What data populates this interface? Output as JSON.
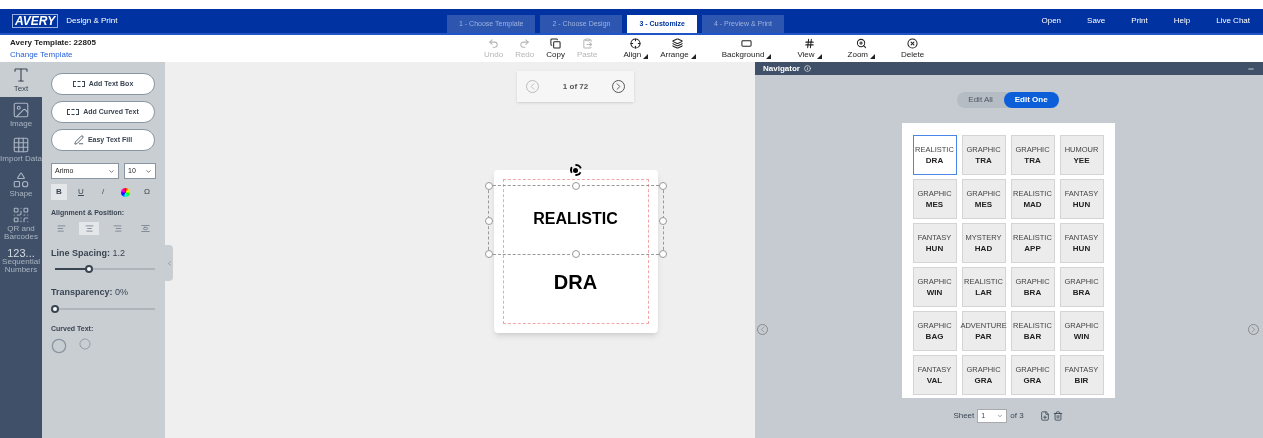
{
  "header": {
    "logo": "AVERY",
    "app_name": "Design & Print",
    "steps": [
      {
        "label": "1 - Choose Template",
        "selected": false
      },
      {
        "label": "2 - Choose Design",
        "selected": false
      },
      {
        "label": "3 - Customize",
        "selected": true
      },
      {
        "label": "4 - Preview & Print",
        "selected": false
      }
    ],
    "menu": [
      "Open",
      "Save",
      "Print",
      "Help",
      "Live Chat"
    ]
  },
  "template": {
    "title": "Avery Template: 22805",
    "link": "Change Template"
  },
  "toolbar": [
    {
      "kind": "undo",
      "label": "Undo",
      "disabled": true,
      "dropdown": false
    },
    {
      "kind": "redo",
      "label": "Redo",
      "disabled": true,
      "dropdown": false
    },
    {
      "kind": "copy",
      "label": "Copy",
      "disabled": false,
      "dropdown": false
    },
    {
      "kind": "paste",
      "label": "Paste",
      "disabled": true,
      "dropdown": false
    },
    {
      "kind": "align",
      "label": "Align",
      "disabled": false,
      "dropdown": true
    },
    {
      "kind": "arrange",
      "label": "Arrange",
      "disabled": false,
      "dropdown": true
    },
    {
      "kind": "background",
      "label": "Background",
      "disabled": false,
      "dropdown": true
    },
    {
      "kind": "view",
      "label": "View",
      "disabled": false,
      "dropdown": true
    },
    {
      "kind": "zoom",
      "label": "Zoom",
      "disabled": false,
      "dropdown": true
    },
    {
      "kind": "delete",
      "label": "Delete",
      "disabled": false,
      "dropdown": false
    }
  ],
  "rail": [
    {
      "kind": "text",
      "label": "Text",
      "selected": true
    },
    {
      "kind": "image",
      "label": "Image",
      "selected": false
    },
    {
      "kind": "data",
      "label": "Import Data",
      "selected": false
    },
    {
      "kind": "shape",
      "label": "Shape",
      "selected": false
    },
    {
      "kind": "qr",
      "label": "QR and Barcodes",
      "selected": false
    },
    {
      "kind": "numbers",
      "glyph": "123...",
      "label": "Sequential Numbers",
      "selected": false
    }
  ],
  "panel": {
    "buttons": [
      {
        "kind": "textbox",
        "label": "Add Text Box"
      },
      {
        "kind": "curved",
        "label": "Add Curved Text"
      },
      {
        "kind": "fill",
        "label": "Easy Text Fill"
      }
    ],
    "font": "Arimo",
    "size": "10",
    "format": [
      {
        "kind": "bold",
        "glyph": "B",
        "selected": true
      },
      {
        "kind": "underline",
        "glyph": "U",
        "selected": false
      },
      {
        "kind": "italic",
        "glyph": "/",
        "selected": false
      },
      {
        "kind": "color",
        "selected": false
      },
      {
        "kind": "symbol",
        "glyph": "Ω",
        "selected": false
      }
    ],
    "alignment_heading": "Alignment & Position:",
    "alignment": [
      {
        "kind": "left",
        "selected": false
      },
      {
        "kind": "center",
        "selected": true
      },
      {
        "kind": "right",
        "selected": false
      },
      {
        "kind": "position",
        "selected": false
      }
    ],
    "line_spacing": {
      "label": "Line Spacing:",
      "reading": "1.2",
      "level": 0.34
    },
    "transparency": {
      "label": "Transparency:",
      "reading": "0%",
      "level": 0
    },
    "curved_heading": "Curved Text:"
  },
  "canvas": {
    "pager": "1 of 72",
    "lines": [
      "REALISTIC",
      "DRA"
    ]
  },
  "navigator": {
    "title": "Navigator",
    "modes": [
      {
        "label": "Edit All",
        "selected": false
      },
      {
        "label": "Edit One",
        "selected": true
      }
    ],
    "cells": [
      {
        "category": "REALISTIC",
        "name": "DRA",
        "selected": true
      },
      {
        "category": "GRAPHIC",
        "name": "TRA",
        "selected": false
      },
      {
        "category": "GRAPHIC",
        "name": "TRA",
        "selected": false
      },
      {
        "category": "HUMOUR",
        "name": "YEE",
        "selected": false
      },
      {
        "category": "GRAPHIC",
        "name": "MES",
        "selected": false
      },
      {
        "category": "GRAPHIC",
        "name": "MES",
        "selected": false
      },
      {
        "category": "REALISTIC",
        "name": "MAD",
        "selected": false
      },
      {
        "category": "FANTASY",
        "name": "HUN",
        "selected": false
      },
      {
        "category": "FANTASY",
        "name": "HUN",
        "selected": false
      },
      {
        "category": "MYSTERY",
        "name": "HAD",
        "selected": false
      },
      {
        "category": "REALISTIC",
        "name": "APP",
        "selected": false
      },
      {
        "category": "FANTASY",
        "name": "HUN",
        "selected": false
      },
      {
        "category": "GRAPHIC",
        "name": "WIN",
        "selected": false
      },
      {
        "category": "REALISTIC",
        "name": "LAR",
        "selected": false
      },
      {
        "category": "GRAPHIC",
        "name": "BRA",
        "selected": false
      },
      {
        "category": "GRAPHIC",
        "name": "BRA",
        "selected": false
      },
      {
        "category": "GRAPHIC",
        "name": "BAG",
        "selected": false
      },
      {
        "category": "ADVENTURE",
        "name": "PAR",
        "selected": false
      },
      {
        "category": "REALISTIC",
        "name": "BAR",
        "selected": false
      },
      {
        "category": "GRAPHIC",
        "name": "WIN",
        "selected": false
      },
      {
        "category": "FANTASY",
        "name": "VAL",
        "selected": false
      },
      {
        "category": "GRAPHIC",
        "name": "GRA",
        "selected": false
      },
      {
        "category": "GRAPHIC",
        "name": "GRA",
        "selected": false
      },
      {
        "category": "FANTASY",
        "name": "BIR",
        "selected": false
      }
    ],
    "sheet_label": "Sheet",
    "sheet_value": "1",
    "sheet_total": "of 3"
  }
}
